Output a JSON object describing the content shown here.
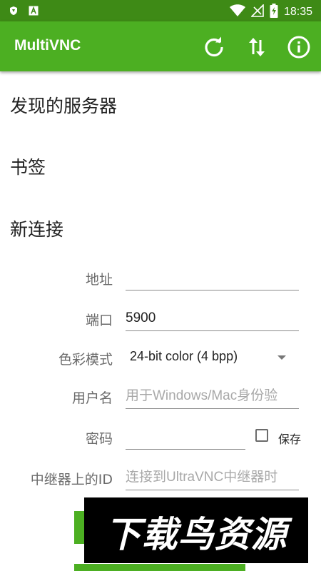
{
  "status_bar": {
    "time": "18:35",
    "icons": [
      "shield-icon",
      "a-icon",
      "wifi-icon",
      "no-signal-icon",
      "battery-charging-icon"
    ]
  },
  "app_bar": {
    "title": "MultiVNC",
    "actions": [
      "refresh-icon",
      "swap-vert-icon",
      "info-icon"
    ],
    "color": "#4caf22"
  },
  "sections": {
    "discovered": "发现的服务器",
    "bookmarks": "书签",
    "new_connection": "新连接"
  },
  "form": {
    "address": {
      "label": "地址",
      "value": ""
    },
    "port": {
      "label": "端口",
      "value": "5900"
    },
    "color_mode": {
      "label": "色彩模式",
      "selected": "24-bit color (4 bpp)"
    },
    "username": {
      "label": "用户名",
      "placeholder": "用于Windows/Mac身份验"
    },
    "password": {
      "label": "密码",
      "value": ""
    },
    "save": {
      "label": "保存",
      "checked": false
    },
    "repeater": {
      "label": "中继器上的ID",
      "placeholder": "连接到UltraVNC中继器时"
    }
  },
  "watermark": {
    "text": "下载鸟资源"
  }
}
